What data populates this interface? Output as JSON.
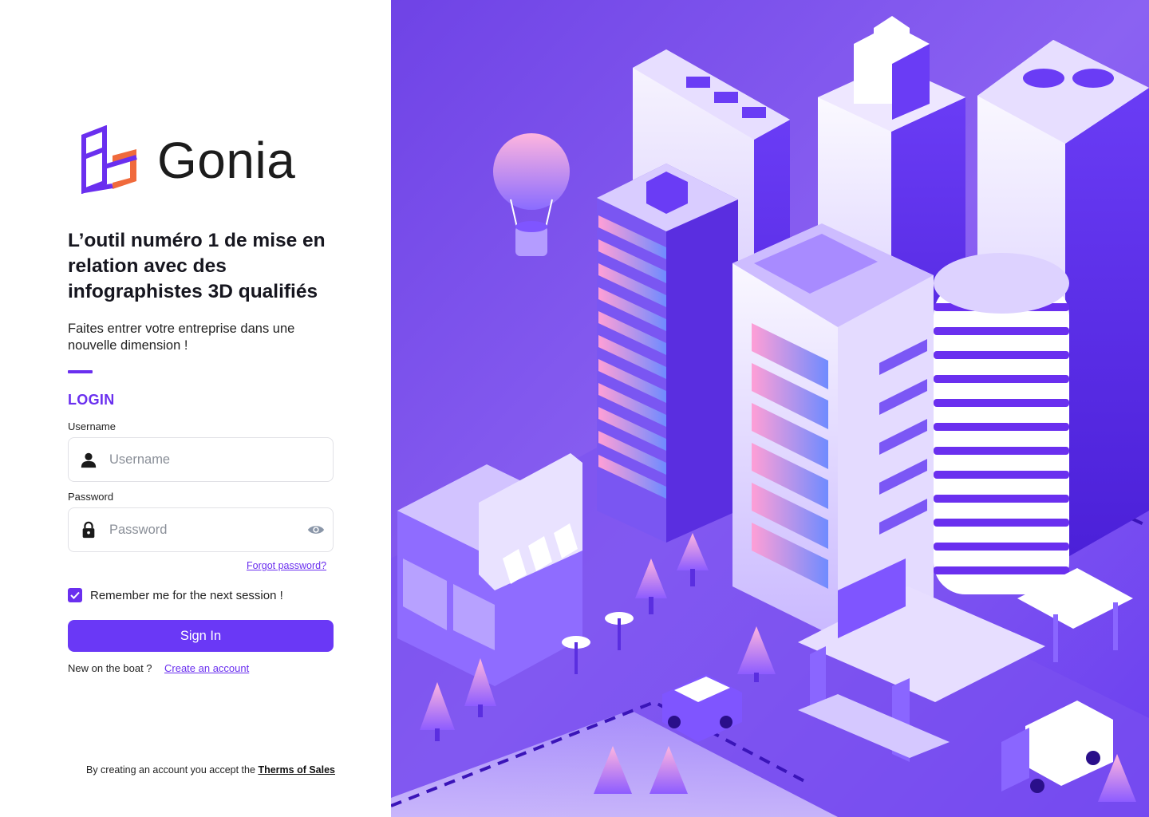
{
  "brand": {
    "name": "Gonia",
    "primary_color": "#6a2fef",
    "secondary_color": "#f06a3c"
  },
  "hero": {
    "headline": "L’outil numéro 1 de mise en relation avec des infographistes 3D qualifiés",
    "subheadline": "Faites entrer votre entreprise dans une nouvelle dimension !"
  },
  "login": {
    "title": "LOGIN",
    "username": {
      "label": "Username",
      "placeholder": "Username",
      "value": "",
      "icon": "user-icon"
    },
    "password": {
      "label": "Password",
      "placeholder": "Password",
      "value": "",
      "icon": "lock-icon",
      "toggle_icon": "eye-icon"
    },
    "forgot_password": "Forgot password?",
    "remember_me": {
      "label": "Remember me for the next session !",
      "checked": true
    },
    "submit_label": "Sign In",
    "new_user_text": "New on the boat ?",
    "create_account_label": "Create an account"
  },
  "footer": {
    "text": "By creating an account you accept the",
    "terms_label": "Therms of Sales"
  },
  "illustration": {
    "subject": "isometric-city-illustration"
  }
}
